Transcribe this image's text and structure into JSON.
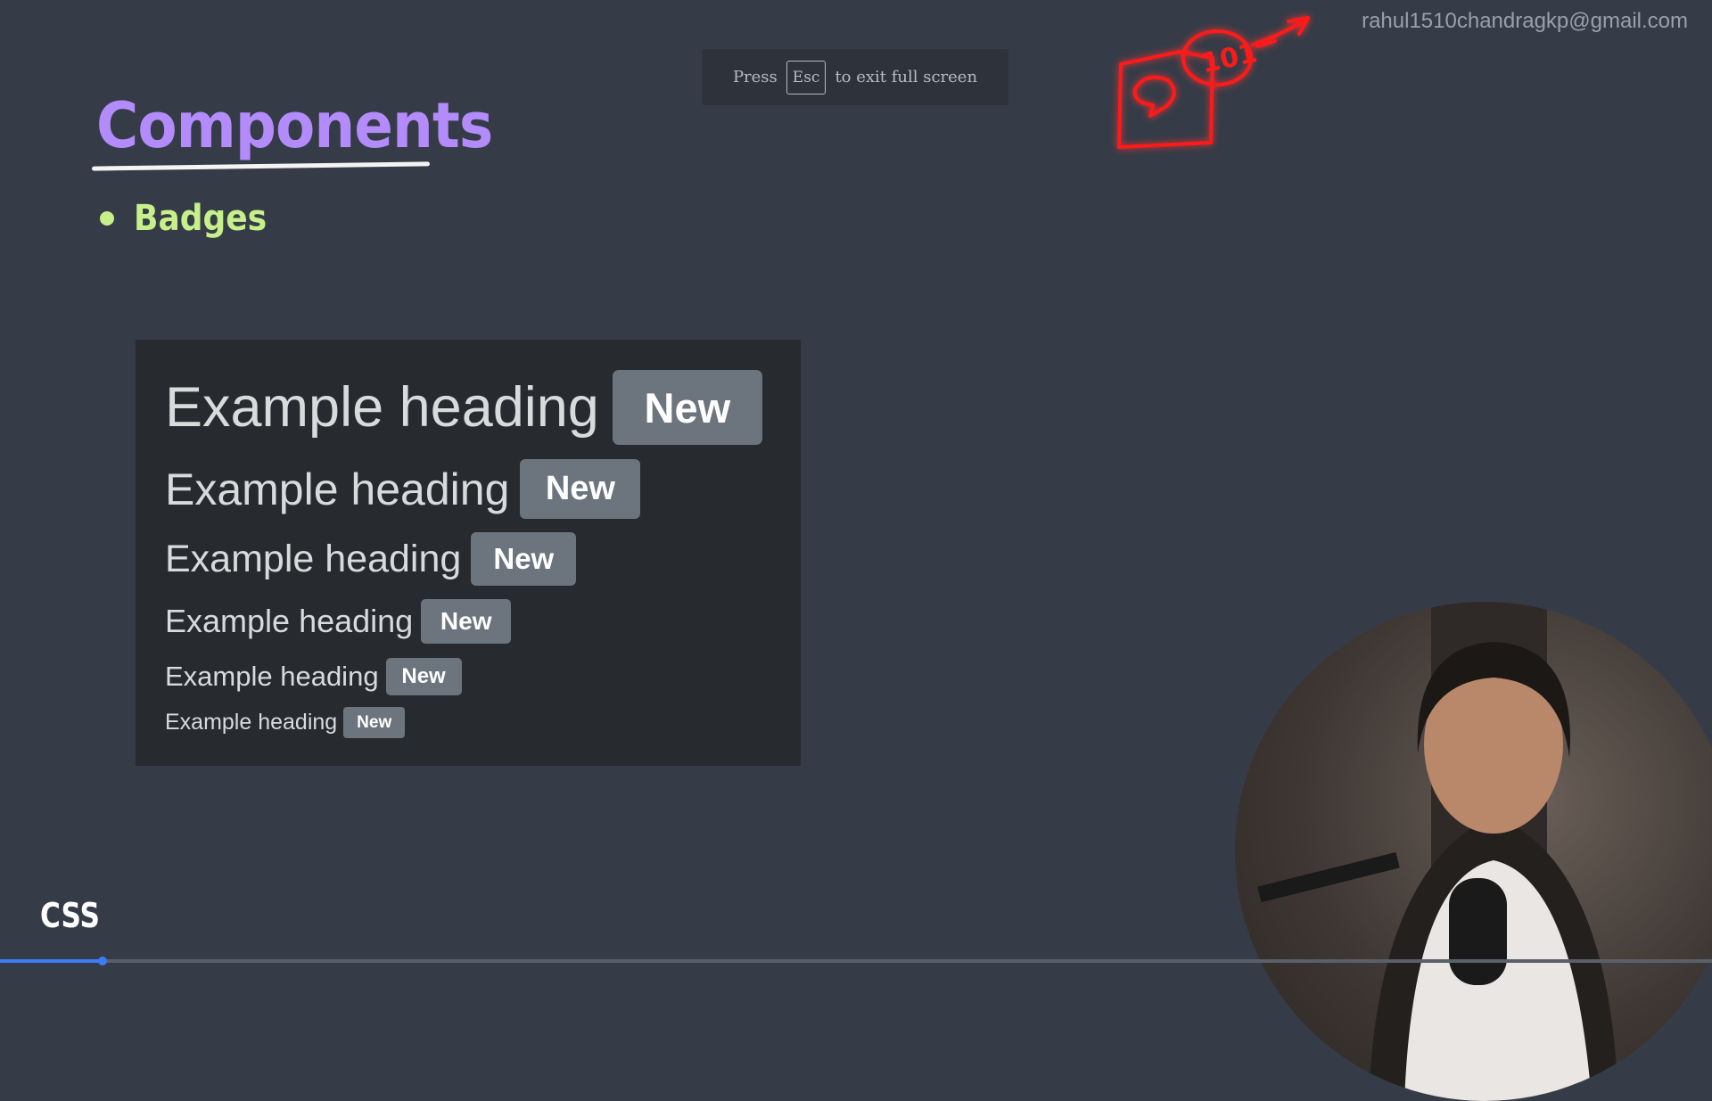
{
  "fullscreen_banner": {
    "prefix": "Press",
    "key": "Esc",
    "suffix": "to exit full screen"
  },
  "email": "rahul1510chandragkp@gmail.com",
  "slide": {
    "title": "Components",
    "bullet": "Badges"
  },
  "demo": {
    "rows": [
      {
        "heading": "Example heading",
        "badge": "New"
      },
      {
        "heading": "Example heading",
        "badge": "New"
      },
      {
        "heading": "Example heading",
        "badge": "New"
      },
      {
        "heading": "Example heading",
        "badge": "New"
      },
      {
        "heading": "Example heading",
        "badge": "New"
      },
      {
        "heading": "Example heading",
        "badge": "New"
      }
    ]
  },
  "annotation": {
    "text": "101",
    "color": "#ff1a1a"
  },
  "footer_label": "CSS",
  "colors": {
    "background": "#353c47",
    "title": "#b38bfa",
    "bullet": "#c8f08a",
    "badge": "#6c757d",
    "progress": "#3e7bfa"
  },
  "playback": {
    "progress_fraction": 0.06
  },
  "webcam": {
    "icon": "presenter-webcam"
  }
}
